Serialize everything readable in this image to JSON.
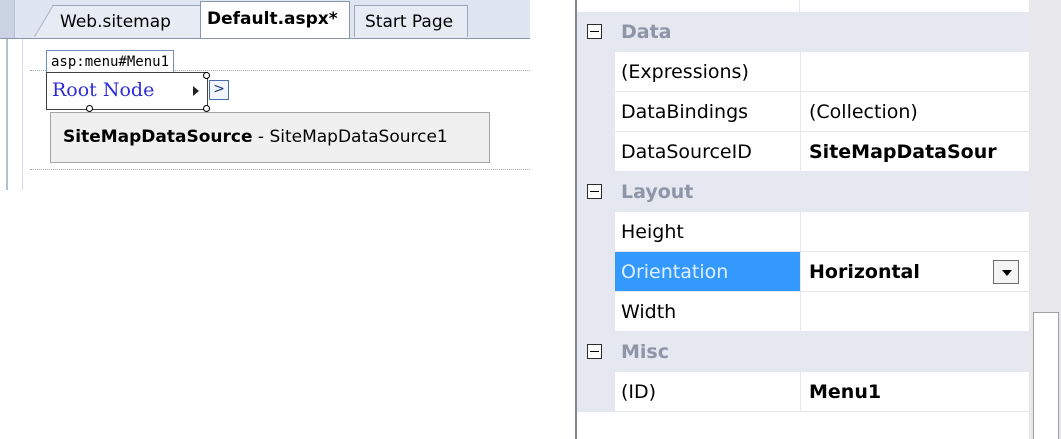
{
  "designer": {
    "tabs": [
      {
        "label": "Web.sitemap",
        "active": false
      },
      {
        "label": "Default.aspx*",
        "active": true
      },
      {
        "label": "Start Page",
        "active": false
      }
    ],
    "control_tag": "asp:menu#Menu1",
    "menu_root": "Root Node",
    "smart_tag_glyph": ">",
    "datasource_type": "SiteMapDataSource",
    "datasource_separator": " - ",
    "datasource_name": "SiteMapDataSource1"
  },
  "properties": {
    "rows": [
      {
        "kind": "category",
        "label": "Data"
      },
      {
        "kind": "property",
        "name": "(Expressions)",
        "value": ""
      },
      {
        "kind": "property",
        "name": "DataBindings",
        "value": "(Collection)"
      },
      {
        "kind": "property",
        "name": "DataSourceID",
        "value": "SiteMapDataSour",
        "bold": true
      },
      {
        "kind": "category",
        "label": "Layout"
      },
      {
        "kind": "property",
        "name": "Height",
        "value": ""
      },
      {
        "kind": "property",
        "name": "Orientation",
        "value": "Horizontal",
        "bold": true,
        "selected": true
      },
      {
        "kind": "property",
        "name": "Width",
        "value": ""
      },
      {
        "kind": "category",
        "label": "Misc"
      },
      {
        "kind": "property",
        "name": "(ID)",
        "value": "Menu1",
        "bold": true
      }
    ]
  },
  "colors": {
    "selection": "#3399ff",
    "category_bg": "#e5e8f1",
    "link_blue": "#2b2bdb"
  }
}
